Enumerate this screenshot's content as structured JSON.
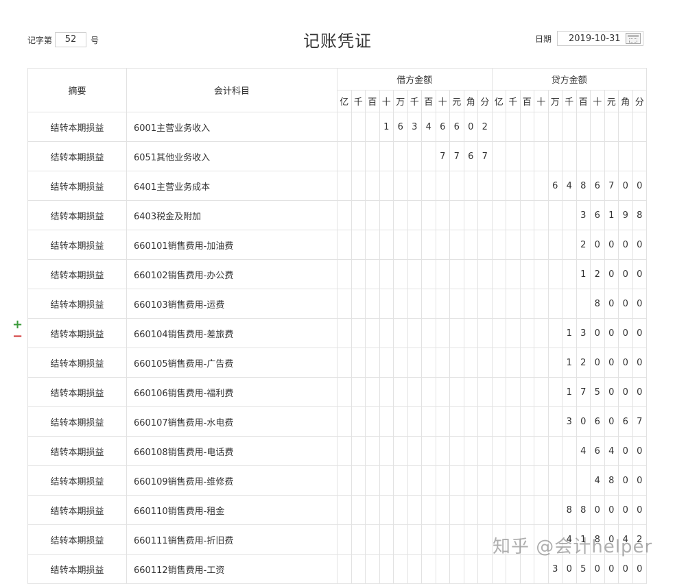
{
  "header": {
    "voucher_prefix": "记字第",
    "voucher_number": "52",
    "voucher_suffix": "号",
    "title": "记账凭证",
    "date_label": "日期",
    "date_value": "2019-10-31"
  },
  "table": {
    "col_summary": "摘要",
    "col_account": "会计科目",
    "col_debit": "借方金额",
    "col_credit": "贷方金额",
    "digit_units": [
      "亿",
      "千",
      "百",
      "十",
      "万",
      "千",
      "百",
      "十",
      "元",
      "角",
      "分"
    ],
    "rows": [
      {
        "summary": "结转本期损益",
        "account": "6001主营业务收入",
        "debit": [
          "",
          "",
          "",
          "1",
          "6",
          "3",
          "4",
          "6",
          "6",
          "0",
          "2"
        ],
        "credit": [
          "",
          "",
          "",
          "",
          "",
          "",
          "",
          "",
          "",
          "",
          ""
        ]
      },
      {
        "summary": "结转本期损益",
        "account": "6051其他业务收入",
        "debit": [
          "",
          "",
          "",
          "",
          "",
          "",
          "",
          "7",
          "7",
          "6",
          "7"
        ],
        "credit": [
          "",
          "",
          "",
          "",
          "",
          "",
          "",
          "",
          "",
          "",
          ""
        ]
      },
      {
        "summary": "结转本期损益",
        "account": "6401主营业务成本",
        "debit": [
          "",
          "",
          "",
          "",
          "",
          "",
          "",
          "",
          "",
          "",
          ""
        ],
        "credit": [
          "",
          "",
          "",
          "",
          "6",
          "4",
          "8",
          "6",
          "7",
          "0",
          "0"
        ]
      },
      {
        "summary": "结转本期损益",
        "account": "6403税金及附加",
        "debit": [
          "",
          "",
          "",
          "",
          "",
          "",
          "",
          "",
          "",
          "",
          ""
        ],
        "credit": [
          "",
          "",
          "",
          "",
          "",
          "",
          "3",
          "6",
          "1",
          "9",
          "8"
        ]
      },
      {
        "summary": "结转本期损益",
        "account": "660101销售费用-加油费",
        "debit": [
          "",
          "",
          "",
          "",
          "",
          "",
          "",
          "",
          "",
          "",
          ""
        ],
        "credit": [
          "",
          "",
          "",
          "",
          "",
          "",
          "2",
          "0",
          "0",
          "0",
          "0"
        ]
      },
      {
        "summary": "结转本期损益",
        "account": "660102销售费用-办公费",
        "debit": [
          "",
          "",
          "",
          "",
          "",
          "",
          "",
          "",
          "",
          "",
          ""
        ],
        "credit": [
          "",
          "",
          "",
          "",
          "",
          "",
          "1",
          "2",
          "0",
          "0",
          "0"
        ]
      },
      {
        "summary": "结转本期损益",
        "account": "660103销售费用-运费",
        "debit": [
          "",
          "",
          "",
          "",
          "",
          "",
          "",
          "",
          "",
          "",
          ""
        ],
        "credit": [
          "",
          "",
          "",
          "",
          "",
          "",
          "",
          "8",
          "0",
          "0",
          "0"
        ]
      },
      {
        "summary": "结转本期损益",
        "account": "660104销售费用-差旅费",
        "debit": [
          "",
          "",
          "",
          "",
          "",
          "",
          "",
          "",
          "",
          "",
          ""
        ],
        "credit": [
          "",
          "",
          "",
          "",
          "",
          "1",
          "3",
          "0",
          "0",
          "0",
          "0"
        ]
      },
      {
        "summary": "结转本期损益",
        "account": "660105销售费用-广告费",
        "debit": [
          "",
          "",
          "",
          "",
          "",
          "",
          "",
          "",
          "",
          "",
          ""
        ],
        "credit": [
          "",
          "",
          "",
          "",
          "",
          "1",
          "2",
          "0",
          "0",
          "0",
          "0"
        ]
      },
      {
        "summary": "结转本期损益",
        "account": "660106销售费用-福利费",
        "debit": [
          "",
          "",
          "",
          "",
          "",
          "",
          "",
          "",
          "",
          "",
          ""
        ],
        "credit": [
          "",
          "",
          "",
          "",
          "",
          "1",
          "7",
          "5",
          "0",
          "0",
          "0"
        ]
      },
      {
        "summary": "结转本期损益",
        "account": "660107销售费用-水电费",
        "debit": [
          "",
          "",
          "",
          "",
          "",
          "",
          "",
          "",
          "",
          "",
          ""
        ],
        "credit": [
          "",
          "",
          "",
          "",
          "",
          "3",
          "0",
          "6",
          "0",
          "6",
          "7"
        ]
      },
      {
        "summary": "结转本期损益",
        "account": "660108销售费用-电话费",
        "debit": [
          "",
          "",
          "",
          "",
          "",
          "",
          "",
          "",
          "",
          "",
          ""
        ],
        "credit": [
          "",
          "",
          "",
          "",
          "",
          "",
          "4",
          "6",
          "4",
          "0",
          "0"
        ]
      },
      {
        "summary": "结转本期损益",
        "account": "660109销售费用-维修费",
        "debit": [
          "",
          "",
          "",
          "",
          "",
          "",
          "",
          "",
          "",
          "",
          ""
        ],
        "credit": [
          "",
          "",
          "",
          "",
          "",
          "",
          "",
          "4",
          "8",
          "0",
          "0"
        ]
      },
      {
        "summary": "结转本期损益",
        "account": "660110销售费用-租金",
        "debit": [
          "",
          "",
          "",
          "",
          "",
          "",
          "",
          "",
          "",
          "",
          ""
        ],
        "credit": [
          "",
          "",
          "",
          "",
          "",
          "8",
          "8",
          "0",
          "0",
          "0",
          "0"
        ]
      },
      {
        "summary": "结转本期损益",
        "account": "660111销售费用-折旧费",
        "debit": [
          "",
          "",
          "",
          "",
          "",
          "",
          "",
          "",
          "",
          "",
          ""
        ],
        "credit": [
          "",
          "",
          "",
          "",
          "",
          "4",
          "1",
          "8",
          "0",
          "4",
          "2"
        ]
      },
      {
        "summary": "结转本期损益",
        "account": "660112销售费用-工资",
        "debit": [
          "",
          "",
          "",
          "",
          "",
          "",
          "",
          "",
          "",
          "",
          ""
        ],
        "credit": [
          "",
          "",
          "",
          "",
          "3",
          "0",
          "5",
          "0",
          "0",
          "0",
          "0"
        ]
      }
    ]
  },
  "row_controls": {
    "add": "+",
    "remove": "−"
  },
  "watermark": "知乎 @会计helper"
}
